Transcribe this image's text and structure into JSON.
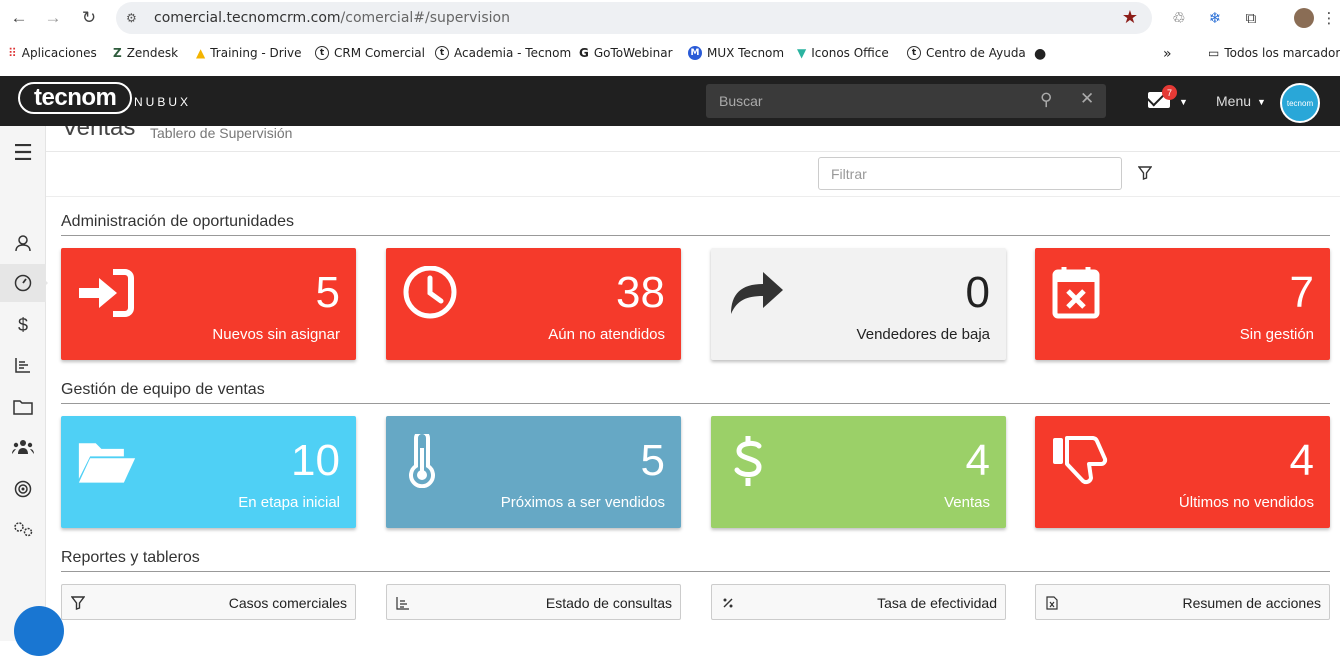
{
  "browser": {
    "url_host": "comercial.tecnomcrm.com",
    "url_path": "/comercial#/supervision",
    "bookmarks": [
      {
        "label": "Aplicaciones",
        "icon": "apps-grid-icon"
      },
      {
        "label": "Zendesk",
        "icon": "zendesk-icon"
      },
      {
        "label": "Training - Drive",
        "icon": "drive-icon"
      },
      {
        "label": "CRM Comercial",
        "icon": "t-icon"
      },
      {
        "label": "Academia - Tecnom",
        "icon": "t-icon"
      },
      {
        "label": "GoToWebinar",
        "icon": "g-icon"
      },
      {
        "label": "MUX Tecnom",
        "icon": "m-icon"
      },
      {
        "label": "Iconos Office",
        "icon": "v-icon"
      },
      {
        "label": "Centro de Ayuda",
        "icon": "t-icon"
      }
    ],
    "overflow": "»",
    "all_bookmarks": "Todos los marcadores"
  },
  "header": {
    "logo": "tecnom",
    "product": "NUBUX",
    "search_placeholder": "Buscar",
    "notifications": "7",
    "menu_label": "Menu",
    "avatar_text": "tecnom"
  },
  "page": {
    "title": "Ventas",
    "subtitle": "Tablero de Supervisión",
    "filter_placeholder": "Filtrar"
  },
  "sections": {
    "opportunities": "Administración de oportunidades",
    "team": "Gestión de equipo de ventas",
    "reports": "Reportes y tableros"
  },
  "tiles_row1": [
    {
      "count": "5",
      "label": "Nuevos sin asignar",
      "color": "#f53a2b",
      "icon": "sign-in-icon"
    },
    {
      "count": "38",
      "label": "Aún no atendidos",
      "color": "#f53a2b",
      "icon": "clock-icon"
    },
    {
      "count": "0",
      "label": "Vendedores de baja",
      "color": "#f2f2f2",
      "icon": "share-arrow-icon"
    },
    {
      "count": "7",
      "label": "Sin gestión",
      "color": "#f53a2b",
      "icon": "calendar-x-icon"
    }
  ],
  "tiles_row2": [
    {
      "count": "10",
      "label": "En etapa inicial",
      "color": "#4fd0f5",
      "icon": "folder-open-icon"
    },
    {
      "count": "5",
      "label": "Próximos a ser vendidos",
      "color": "#66a8c5",
      "icon": "thermometer-icon"
    },
    {
      "count": "4",
      "label": "Ventas",
      "color": "#9bd068",
      "icon": "dollar-icon"
    },
    {
      "count": "4",
      "label": "Últimos no vendidos",
      "color": "#f53a2b",
      "icon": "thumbs-down-icon"
    }
  ],
  "reports": [
    {
      "label": "Casos comerciales",
      "icon": "funnel-icon"
    },
    {
      "label": "Estado de consultas",
      "icon": "bar-chart-icon"
    },
    {
      "label": "Tasa de efectividad",
      "icon": "percent-icon"
    },
    {
      "label": "Resumen de acciones",
      "icon": "excel-file-icon"
    }
  ]
}
